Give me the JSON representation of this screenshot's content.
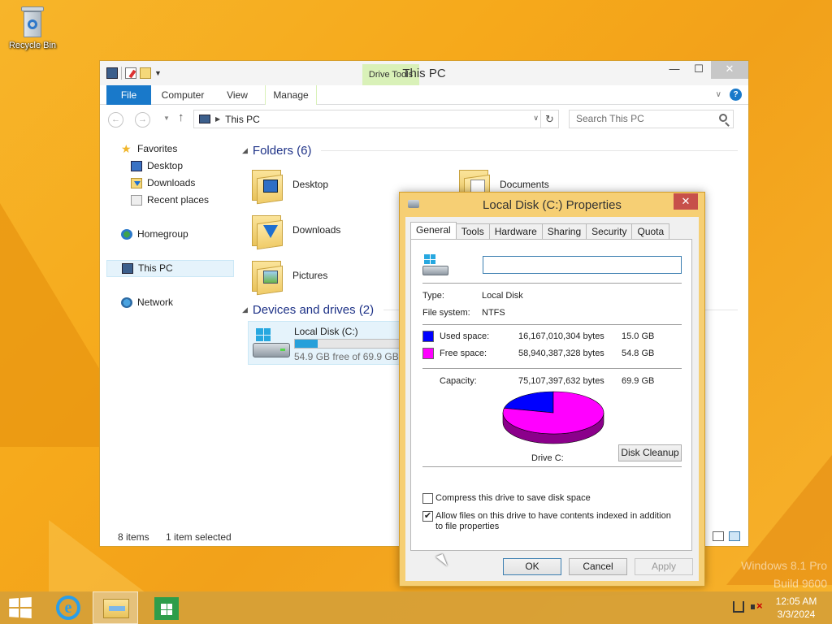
{
  "desktop": {
    "recycle_bin_label": "Recycle Bin",
    "watermark_line1": "Windows 8.1 Pro",
    "watermark_line2": "Build 9600"
  },
  "explorer": {
    "title": "This PC",
    "drive_tools_label": "Drive Tools",
    "tabs": {
      "file": "File",
      "computer": "Computer",
      "view": "View",
      "manage": "Manage"
    },
    "address": "This PC",
    "search_placeholder": "Search This PC",
    "sidebar": {
      "favorites": "Favorites",
      "desktop": "Desktop",
      "downloads": "Downloads",
      "recent": "Recent places",
      "homegroup": "Homegroup",
      "this_pc": "This PC",
      "network": "Network"
    },
    "folders_header": "Folders (6)",
    "folders": {
      "desktop": "Desktop",
      "documents": "Documents",
      "downloads": "Downloads",
      "pictures": "Pictures"
    },
    "devices_header": "Devices and drives (2)",
    "drive": {
      "name": "Local Disk (C:)",
      "free_text": "54.9 GB free of 69.9 GB",
      "used_fraction": 0.215
    },
    "status": {
      "count": "8 items",
      "selected": "1 item selected"
    }
  },
  "dialog": {
    "title": "Local Disk (C:) Properties",
    "tabs": [
      "General",
      "Tools",
      "Hardware",
      "Sharing",
      "Security",
      "Quota"
    ],
    "label_value": "",
    "type_label": "Type:",
    "type_value": "Local Disk",
    "fs_label": "File system:",
    "fs_value": "NTFS",
    "used_label": "Used space:",
    "used_bytes": "16,167,010,304 bytes",
    "used_gb": "15.0 GB",
    "free_label": "Free space:",
    "free_bytes": "58,940,387,328 bytes",
    "free_gb": "54.8 GB",
    "capacity_label": "Capacity:",
    "capacity_bytes": "75,107,397,632 bytes",
    "capacity_gb": "69.9 GB",
    "drive_label": "Drive C:",
    "disk_cleanup": "Disk Cleanup",
    "compress_label": "Compress this drive to save disk space",
    "index_label": "Allow files on this drive to have contents indexed in addition to file properties",
    "ok": "OK",
    "cancel": "Cancel",
    "apply": "Apply",
    "colors": {
      "used": "#0000ff",
      "free": "#ff00ff"
    }
  },
  "chart_data": {
    "type": "pie",
    "categories": [
      "Used space",
      "Free space"
    ],
    "values": [
      15.0,
      54.8
    ]
  },
  "taskbar": {
    "time": "12:05 AM",
    "date": "3/3/2024"
  }
}
